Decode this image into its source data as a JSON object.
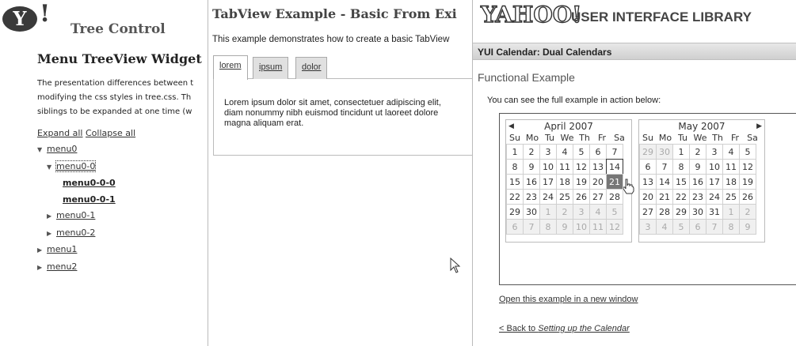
{
  "tree_pane": {
    "logo_letter": "Y",
    "logo_bang": "!",
    "title": "Tree Control",
    "heading": "Menu TreeView Widget",
    "description_lines": [
      "The presentation differences between t",
      "modifying the css styles in tree.css. Th",
      "siblings to be expanded at one time (w"
    ],
    "expand_all": "Expand all",
    "collapse_all": "Collapse all",
    "nodes": [
      "menu0",
      "menu0-0",
      "menu0-0-0",
      "menu0-0-1",
      "menu0-1",
      "menu0-2",
      "menu1",
      "menu2"
    ],
    "icons": {
      "expanded": "triangle-down-icon",
      "collapsed": "triangle-right-icon"
    }
  },
  "tab_pane": {
    "title": "TabView Example - Basic From Exi",
    "description": "This example demonstrates how to create a basic TabView",
    "tabs": [
      "lorem",
      "ipsum",
      "dolor"
    ],
    "selected_tab": "lorem",
    "content_lines": [
      "Lorem ipsum dolor sit amet, consectetuer adipiscing elit,",
      "diam nonummy nibh euismod tincidunt ut laoreet dolore",
      "magna aliquam erat."
    ]
  },
  "cal_pane": {
    "logo": "YAHOO!",
    "library": "USER INTERFACE LIBRARY",
    "bar_title": "YUI Calendar: Dual Calendars",
    "functional": "Functional Example",
    "see_full": "You can see the full example in action below:",
    "weekdays": [
      "Su",
      "Mo",
      "Tu",
      "We",
      "Th",
      "Fr",
      "Sa"
    ],
    "months": [
      {
        "title": "April 2007",
        "weeks": [
          [
            "1",
            "2",
            "3",
            "4",
            "5",
            "6",
            "7"
          ],
          [
            "8",
            "9",
            "10",
            "11",
            "12",
            "13",
            "14"
          ],
          [
            "15",
            "16",
            "17",
            "18",
            "19",
            "20",
            "21"
          ],
          [
            "22",
            "23",
            "24",
            "25",
            "26",
            "27",
            "28"
          ],
          [
            "29",
            "30",
            "1",
            "2",
            "3",
            "4",
            "5"
          ],
          [
            "6",
            "7",
            "8",
            "9",
            "10",
            "11",
            "12"
          ]
        ],
        "out_of_month": [
          [
            4,
            2
          ],
          [
            4,
            3
          ],
          [
            4,
            4
          ],
          [
            4,
            5
          ],
          [
            4,
            6
          ],
          [
            5,
            0
          ],
          [
            5,
            1
          ],
          [
            5,
            2
          ],
          [
            5,
            3
          ],
          [
            5,
            4
          ],
          [
            5,
            5
          ],
          [
            5,
            6
          ]
        ],
        "today": [
          1,
          6
        ],
        "selected": [
          2,
          6
        ]
      },
      {
        "title": "May 2007",
        "weeks": [
          [
            "29",
            "30",
            "1",
            "2",
            "3",
            "4",
            "5"
          ],
          [
            "6",
            "7",
            "8",
            "9",
            "10",
            "11",
            "12"
          ],
          [
            "13",
            "14",
            "15",
            "16",
            "17",
            "18",
            "19"
          ],
          [
            "20",
            "21",
            "22",
            "23",
            "24",
            "25",
            "26"
          ],
          [
            "27",
            "28",
            "29",
            "30",
            "31",
            "1",
            "2"
          ],
          [
            "3",
            "4",
            "5",
            "6",
            "7",
            "8",
            "9"
          ]
        ],
        "out_of_month": [
          [
            0,
            0
          ],
          [
            0,
            1
          ],
          [
            4,
            5
          ],
          [
            4,
            6
          ],
          [
            5,
            0
          ],
          [
            5,
            1
          ],
          [
            5,
            2
          ],
          [
            5,
            3
          ],
          [
            5,
            4
          ],
          [
            5,
            5
          ],
          [
            5,
            6
          ]
        ],
        "today": null,
        "selected": null
      }
    ],
    "open_link": "Open this example in a new window",
    "back_prefix": "< Back to ",
    "back_target": "Setting up the Calendar"
  }
}
